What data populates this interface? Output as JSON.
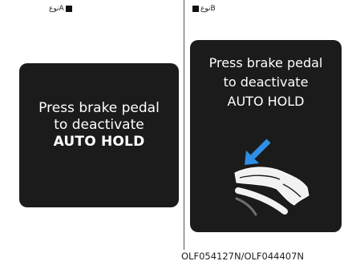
{
  "panels": {
    "a": {
      "label": "نوعA",
      "message_lines": [
        "Press brake pedal",
        "to deactivate",
        "AUTO HOLD"
      ]
    },
    "b": {
      "label": "نوعB",
      "message_lines": [
        "Press brake pedal",
        "to deactivate",
        "AUTO HOLD"
      ],
      "graphic": "foot-pressing-brake-pedal-icon"
    }
  },
  "footer": {
    "figure_code": "OLF054127N/OLF044407N"
  },
  "colors": {
    "display_background": "#1b1b1b",
    "display_text": "#ffffff",
    "arrow_accent": "#2f8fe6"
  }
}
